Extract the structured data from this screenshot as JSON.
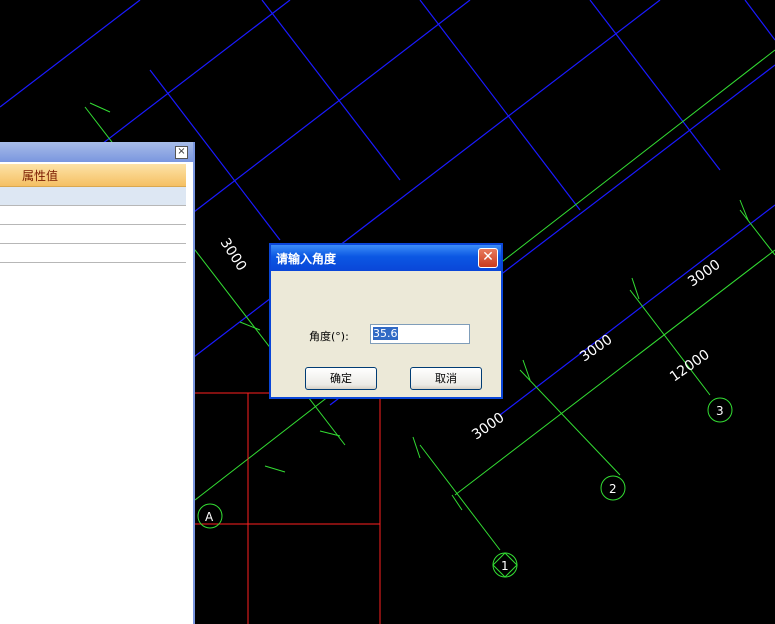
{
  "drawing": {
    "dimensions": [
      "3000",
      "3000",
      "3000",
      "3000",
      "3000",
      "12000"
    ],
    "axis_labels": [
      "1",
      "2",
      "3",
      "A"
    ],
    "colors": {
      "grid_blue": "#1a1aff",
      "dim_green": "#33dd33",
      "wall_red": "#ff2020",
      "background": "#000000"
    }
  },
  "properties_panel": {
    "close_icon": "close-icon",
    "header_label": "属性值"
  },
  "dialog": {
    "title": "请输入角度",
    "close_symbol": "✕",
    "angle_label": "角度(°):",
    "angle_value": "35.6",
    "ok_label": "确定",
    "cancel_label": "取消"
  }
}
